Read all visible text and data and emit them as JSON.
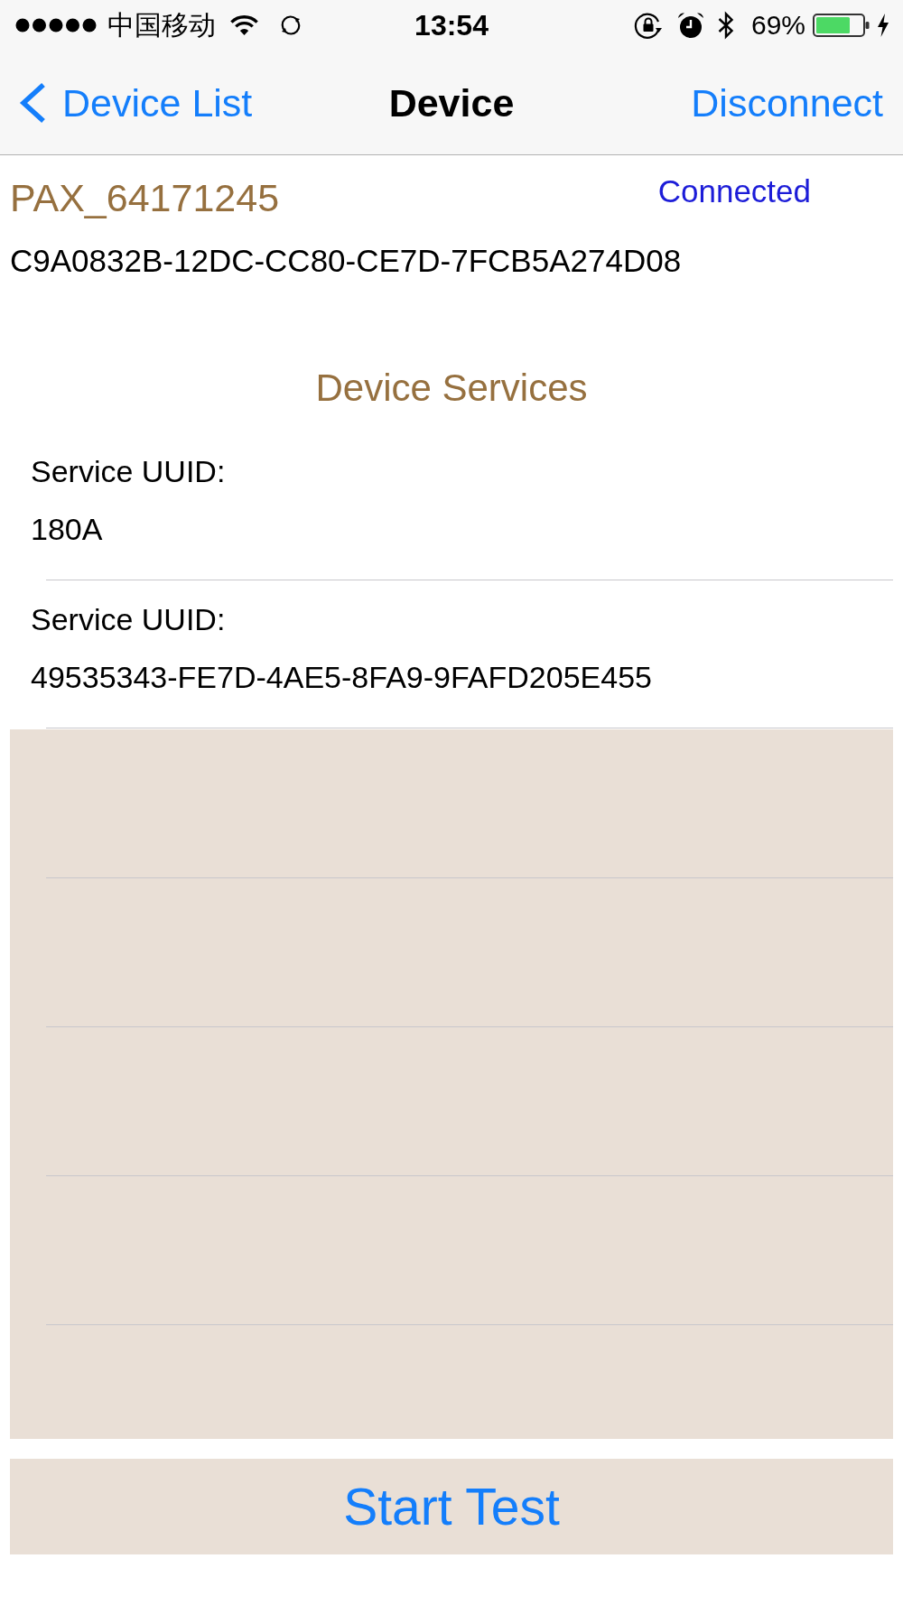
{
  "status_bar": {
    "carrier": "中国移动",
    "time": "13:54",
    "battery_percent": "69%"
  },
  "nav_bar": {
    "back_label": "Device List",
    "title": "Device",
    "right_button": "Disconnect"
  },
  "device": {
    "name": "PAX_64171245",
    "status": "Connected",
    "uuid": "C9A0832B-12DC-CC80-CE7D-7FCB5A274D08"
  },
  "services": {
    "title": "Device Services",
    "items": [
      {
        "label": "Service UUID:",
        "uuid": "180A"
      },
      {
        "label": "Service UUID:",
        "uuid": "49535343-FE7D-4AE5-8FA9-9FAFD205E455"
      }
    ]
  },
  "start_button": {
    "label": "Start Test"
  }
}
